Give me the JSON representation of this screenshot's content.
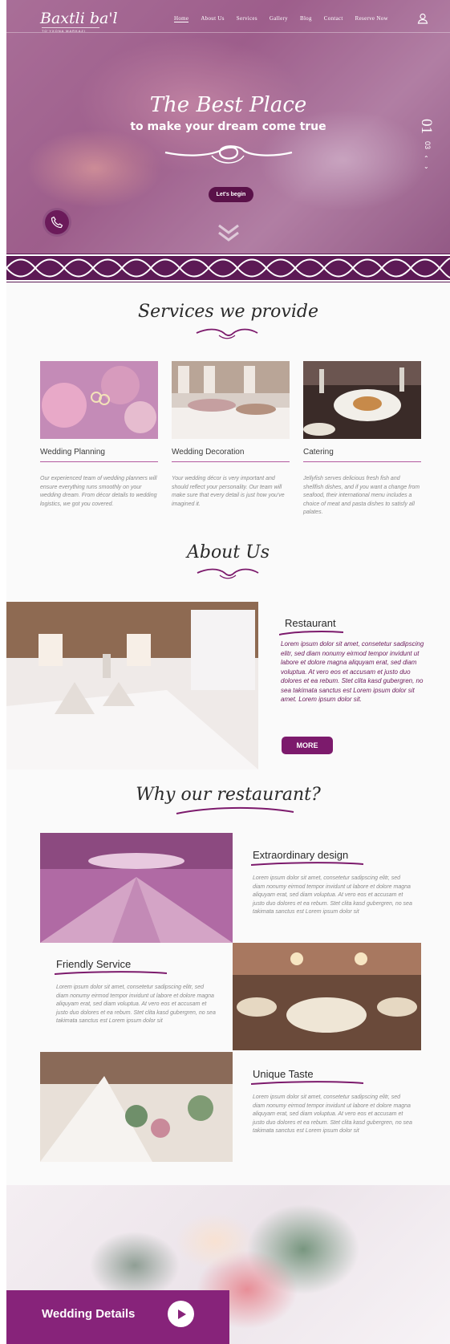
{
  "brand": {
    "logo": "Baxtli ba'l",
    "tagline": "TO'YXONA MARKAZI"
  },
  "nav": {
    "items": [
      "Home",
      "About Us",
      "Services",
      "Gallery",
      "Blog",
      "Contact",
      "Reserve Now"
    ]
  },
  "hero": {
    "title": "The Best Place",
    "subtitle": "to make your dream come true",
    "button": "Let's begin",
    "slide_current": "01",
    "slide_total": "03"
  },
  "services": {
    "title": "Services we provide",
    "items": [
      {
        "name": "Wedding Planning",
        "desc": "Our experienced team of wedding planners will ensure everything runs smoothly on your wedding dream. From décor details to wedding logistics, we got you covered."
      },
      {
        "name": "Wedding Decoration",
        "desc": "Your wedding décor is very important and should reflect your personality. Our team will make sure that every detail is just how you've imagined it."
      },
      {
        "name": "Catering",
        "desc": "Jellyfish serves delicious fresh fish and shellfish dishes, and if you want a change from seafood, their international menu includes a choice of meat and pasta dishes to satisfy all palates."
      }
    ]
  },
  "about": {
    "title": "About Us",
    "heading": "Restaurant",
    "text": "Lorem ipsum dolor sit amet, consetetur sadipscing elitr, sed diam nonumy eirmod tempor invidunt ut labore et dolore magna aliquyam erat, sed diam voluptua. At vero eos et accusam et justo duo dolores et ea rebum. Stet clita kasd gubergren, no sea takimata sanctus est Lorem ipsum dolor sit amet. Lorem ipsum dolor sit.",
    "button": "MORE"
  },
  "why": {
    "title": "Why our restaurant?",
    "items": [
      {
        "heading": "Extraordinary design",
        "text": "Lorem ipsum dolor sit amet, consetetur sadipscing elitr, sed diam nonumy eirmod tempor invidunt ut labore et dolore magna aliquyam erat, sed diam voluptua. At vero eos et accusam et justo duo dolores et ea rebum. Stet clita kasd gubergren, no sea takimata sanctus est Lorem ipsum dolor sit"
      },
      {
        "heading": "Friendly Service",
        "text": "Lorem ipsum dolor sit amet, consetetur sadipscing elitr, sed diam nonumy eirmod tempor invidunt ut labore et dolore magna aliquyam erat, sed diam voluptua. At vero eos et accusam et justo duo dolores et ea rebum. Stet clita kasd gubergren, no sea takimata sanctus est Lorem ipsum dolor sit"
      },
      {
        "heading": "Unique Taste",
        "text": "Lorem ipsum dolor sit amet, consetetur sadipscing elitr, sed diam nonumy eirmod tempor invidunt ut labore et dolore magna aliquyam erat, sed diam voluptua. At vero eos et accusam et justo duo dolores et ea rebum. Stet clita kasd gubergren, no sea takimata sanctus est Lorem ipsum dolor sit"
      }
    ]
  },
  "details": {
    "label": "Wedding Details"
  },
  "colors": {
    "primary": "#7c1a6c",
    "dark": "#5a1149",
    "accent": "#87237a"
  }
}
